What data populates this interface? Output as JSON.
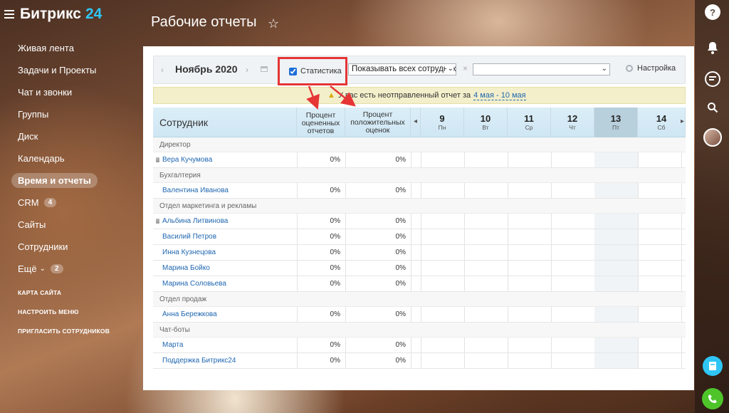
{
  "app": {
    "logo_text": "Битрикс",
    "logo_num": "24"
  },
  "sidebar": {
    "items": [
      {
        "label": "Живая лента"
      },
      {
        "label": "Задачи и Проекты"
      },
      {
        "label": "Чат и звонки"
      },
      {
        "label": "Группы"
      },
      {
        "label": "Диск"
      },
      {
        "label": "Календарь"
      },
      {
        "label": "Время и отчеты",
        "active": true
      },
      {
        "label": "CRM",
        "counter": "4"
      },
      {
        "label": "Сайты"
      },
      {
        "label": "Сотрудники"
      },
      {
        "label": "Ещё",
        "counter": "2"
      }
    ],
    "links": [
      "КАРТА САЙТА",
      "НАСТРОИТЬ МЕНЮ",
      "ПРИГЛАСИТЬ СОТРУДНИКОВ"
    ]
  },
  "page": {
    "title": "Рабочие отчеты"
  },
  "toolbar": {
    "month": "Ноябрь 2020",
    "stat_label": "Статистика",
    "stat_checked": true,
    "employees_select": "Показывать всех сотрудников",
    "dept_select": "",
    "settings_label": "Настройка"
  },
  "warning": {
    "text": "У вас есть неотправленный отчет за",
    "link": "4 мая - 10 мая"
  },
  "grid": {
    "col_employee": "Сотрудник",
    "col_rated": "Процент оцененных отчетов",
    "col_positive": "Процент положительных оценок",
    "days": [
      {
        "num": "9",
        "name": "Пн"
      },
      {
        "num": "10",
        "name": "Вт"
      },
      {
        "num": "11",
        "name": "Ср"
      },
      {
        "num": "12",
        "name": "Чт"
      },
      {
        "num": "13",
        "name": "Пт",
        "today": true
      },
      {
        "num": "14",
        "name": "Сб"
      }
    ],
    "groups": [
      {
        "name": "Директор",
        "rows": [
          {
            "name": "Вера Кучумова",
            "rated": "0%",
            "positive": "0%",
            "boss": true
          }
        ]
      },
      {
        "name": "Бухгалтерия",
        "rows": [
          {
            "name": "Валентина Иванова",
            "rated": "0%",
            "positive": "0%"
          }
        ]
      },
      {
        "name": "Отдел маркетинга и рекламы",
        "rows": [
          {
            "name": "Альбина Литвинова",
            "rated": "0%",
            "positive": "0%",
            "boss": true
          },
          {
            "name": "Василий Петров",
            "rated": "0%",
            "positive": "0%"
          },
          {
            "name": "Инна Кузнецова",
            "rated": "0%",
            "positive": "0%"
          },
          {
            "name": "Марина Бойко",
            "rated": "0%",
            "positive": "0%"
          },
          {
            "name": "Марина Соловьева",
            "rated": "0%",
            "positive": "0%"
          }
        ]
      },
      {
        "name": "Отдел продаж",
        "rows": [
          {
            "name": "Анна Бережкова",
            "rated": "0%",
            "positive": "0%"
          }
        ]
      },
      {
        "name": "Чат-боты",
        "rows": [
          {
            "name": "Марта",
            "rated": "0%",
            "positive": "0%"
          },
          {
            "name": "Поддержка Битрикс24",
            "rated": "0%",
            "positive": "0%"
          }
        ]
      }
    ]
  },
  "icons": {
    "help": "help-icon",
    "bell": "bell-icon",
    "chat": "chat-icon",
    "search": "search-icon",
    "avatar": "avatar",
    "phone": "phone-icon",
    "timeman": "timeman-icon"
  },
  "colors": {
    "accent": "#2fc6f6",
    "highlight": "#e53535",
    "link": "#2067b0",
    "phone": "#4ec42b"
  }
}
